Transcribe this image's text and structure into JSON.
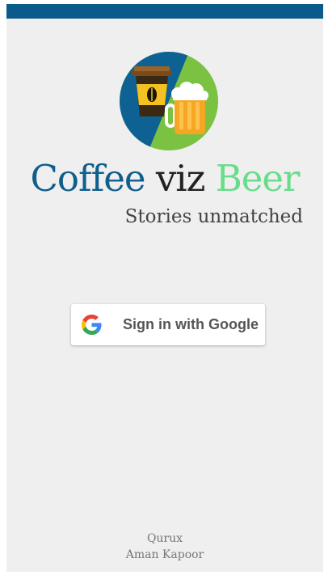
{
  "app": {
    "title_parts": {
      "coffee": "Coffee",
      "viz": "viz",
      "beer": "Beer"
    },
    "tagline": "Stories unmatched",
    "logo": "coffee-beer-logo"
  },
  "signin": {
    "label": "Sign in with Google",
    "icon": "google-g-icon"
  },
  "footer": {
    "company": "Qurux",
    "author": "Aman Kapoor"
  },
  "colors": {
    "status_bar": "#0b5a8c",
    "coffee": "#0f5f8d",
    "beer": "#66dd8a",
    "background": "#efefef"
  }
}
